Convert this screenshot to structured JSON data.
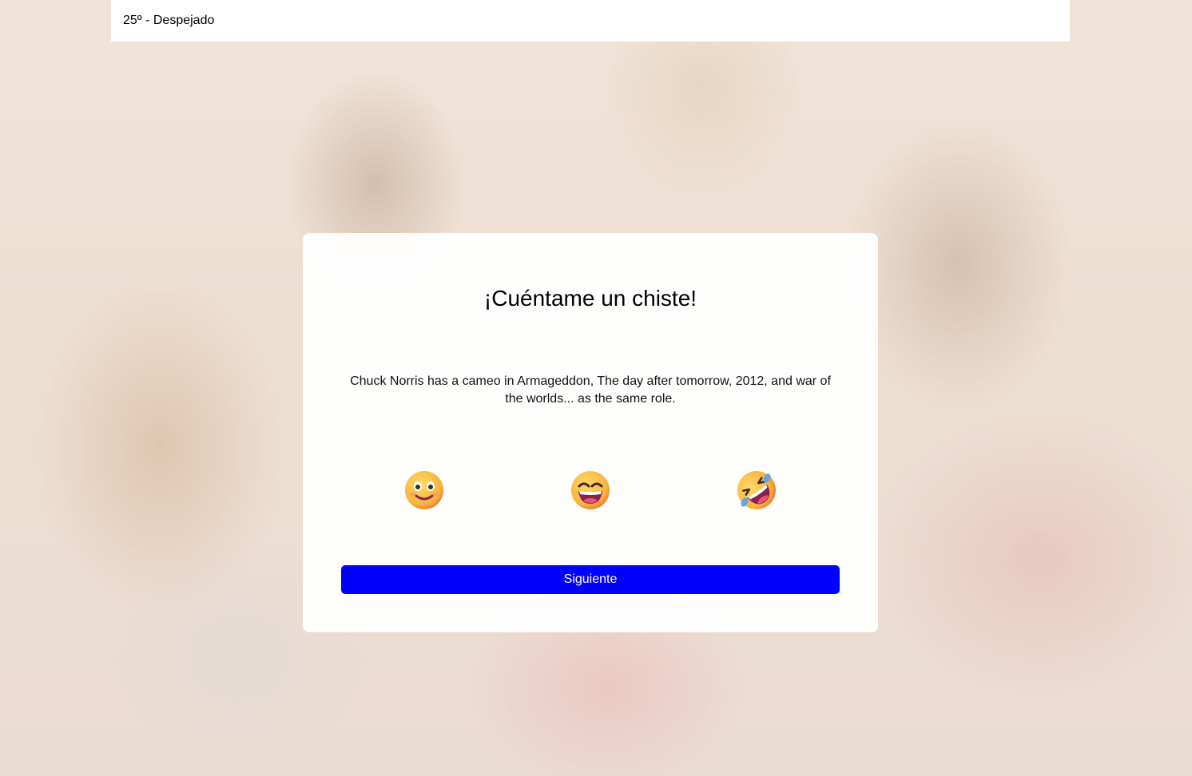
{
  "header": {
    "weather_text": "25º - Despejado"
  },
  "card": {
    "title": "¡Cuéntame un chiste!",
    "joke": "Chuck Norris has a cameo in Armageddon, The day after tomorrow, 2012, and war of the worlds... as the same role.",
    "ratings": [
      {
        "icon": "slightly-smiling-face-icon"
      },
      {
        "icon": "grinning-squinting-face-icon"
      },
      {
        "icon": "rolling-on-floor-laughing-icon"
      }
    ],
    "next_label": "Siguiente"
  },
  "colors": {
    "primary_button": "#0000ff",
    "button_text": "#ffffff",
    "emoji_face": "#f7b43b",
    "emoji_mouth": "#8a1f4f"
  }
}
